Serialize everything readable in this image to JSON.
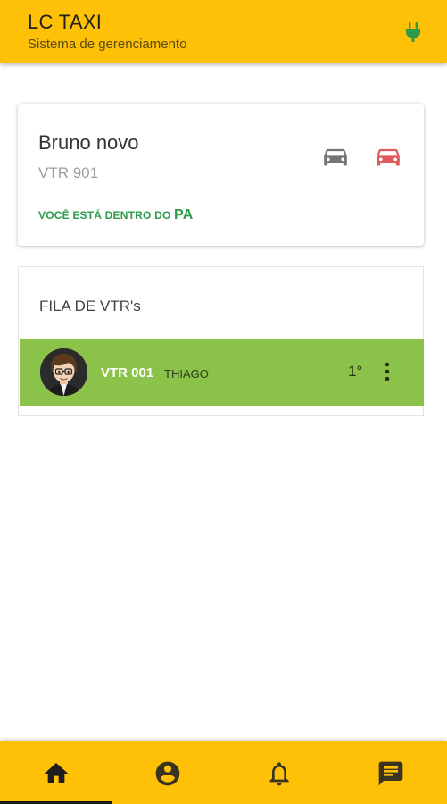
{
  "header": {
    "title": "LC TAXI",
    "subtitle": "Sistema de gerenciamento",
    "icon": "plug-icon"
  },
  "driver_card": {
    "name": "Bruno novo",
    "vehicle": "VTR 901",
    "status_prefix": "VOCÊ ESTÁ DENTRO DO",
    "status_zone": "PA",
    "icons": [
      "car-icon-gray",
      "car-icon-red"
    ]
  },
  "queue": {
    "title": "FILA DE VTR's",
    "items": [
      {
        "vtr": "VTR 001",
        "driver": "THIAGO",
        "position": "1°"
      }
    ]
  },
  "bottom_nav": {
    "items": [
      {
        "name": "home",
        "icon": "home-icon",
        "active": true
      },
      {
        "name": "profile",
        "icon": "account-circle-icon",
        "active": false
      },
      {
        "name": "notifications",
        "icon": "bell-icon",
        "active": false
      },
      {
        "name": "messages",
        "icon": "chat-icon",
        "active": false
      }
    ]
  },
  "colors": {
    "primary": "#FFC107",
    "queue_highlight": "#8BC34A",
    "status_green": "#2E9B4A",
    "car_red": "#E05A5A",
    "car_gray": "#757575"
  }
}
